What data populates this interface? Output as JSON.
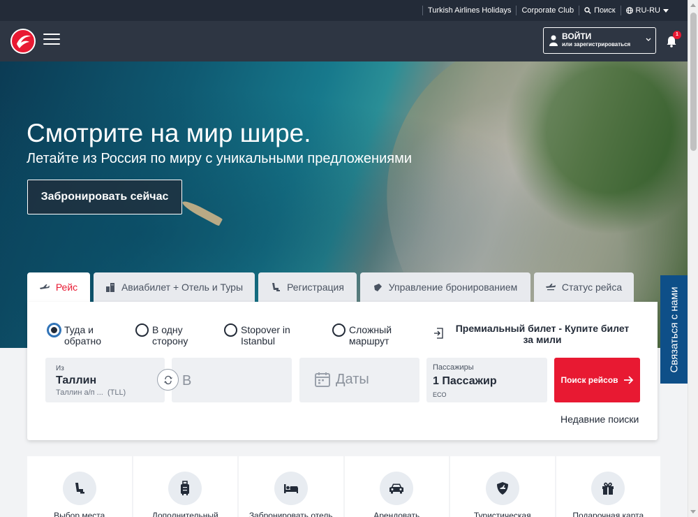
{
  "topbar": {
    "links": [
      {
        "label": "Turkish Airlines Holidays",
        "icon": ""
      },
      {
        "label": "Corporate Club",
        "icon": ""
      },
      {
        "label": "Поиск",
        "icon": "search-icon"
      },
      {
        "label": "RU-RU",
        "icon": "globe-icon"
      }
    ]
  },
  "header": {
    "login_label": "ВОЙТИ",
    "login_sub": "или зарегистрироваться",
    "notification_count": "1"
  },
  "hero": {
    "title": "Смотрите на мир шире.",
    "subtitle": "Летайте из Россия по миру с уникальными предложениями",
    "cta": "Забронировать сейчас"
  },
  "tabs": [
    {
      "label": "Рейс",
      "icon": "plane-icon",
      "active": true
    },
    {
      "label": "Авиабилет + Отель и Туры",
      "icon": "building-icon",
      "active": false
    },
    {
      "label": "Регистрация",
      "icon": "seat-icon",
      "active": false
    },
    {
      "label": "Управление бронированием",
      "icon": "briefcase-icon",
      "active": false
    },
    {
      "label": "Статус рейса",
      "icon": "flight-status-icon",
      "active": false
    }
  ],
  "trip_types": [
    {
      "label": "Туда и обратно",
      "selected": true
    },
    {
      "label": "В одну сторону",
      "selected": false
    },
    {
      "label": "Stopover in Istanbul",
      "selected": false
    },
    {
      "label": "Сложный маршрут",
      "selected": false
    }
  ],
  "premium": {
    "label": "Премиальный билет - Купите билет за мили"
  },
  "search": {
    "from_label": "Из",
    "from_value": "Таллин",
    "from_sub": "Таллин а/п ...",
    "from_code": "(TLL)",
    "to_placeholder": "В",
    "date_placeholder": "Даты",
    "passengers_label": "Пассажиры",
    "passengers_value": "1 Пассажир",
    "cabin": "ECO",
    "search_button": "Поиск рейсов",
    "recent": "Недавние поиски"
  },
  "contact_tab": "Связаться с нами",
  "services": [
    {
      "label": "Выбор места",
      "icon": "seat-icon"
    },
    {
      "label": "Дополнительный",
      "icon": "luggage-icon"
    },
    {
      "label": "Забронировать отель",
      "icon": "bed-icon"
    },
    {
      "label": "Арендовать",
      "icon": "car-icon"
    },
    {
      "label": "Туристическая",
      "icon": "shield-icon"
    },
    {
      "label": "Подарочная карта",
      "icon": "gift-icon"
    }
  ],
  "colors": {
    "brand_red": "#e81932",
    "header_dark": "#2e3643",
    "contact_blue": "#0e4f88"
  }
}
